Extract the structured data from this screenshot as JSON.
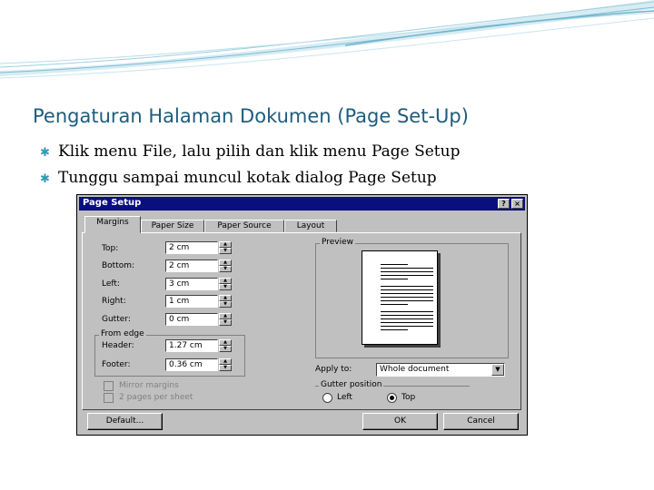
{
  "slide": {
    "title": "Pengaturan Halaman Dokumen (Page Set-Up)",
    "bullets": [
      "Klik menu File, lalu pilih dan klik menu Page Setup",
      "Tunggu sampai muncul kotak dialog Page Setup"
    ]
  },
  "dialog": {
    "title": "Page Setup",
    "title_buttons": [
      "?",
      "×"
    ],
    "tabs": [
      "Margins",
      "Paper Size",
      "Paper Source",
      "Layout"
    ],
    "fields": [
      {
        "label": "Top:",
        "value": "2 cm"
      },
      {
        "label": "Bottom:",
        "value": "2 cm"
      },
      {
        "label": "Left:",
        "value": "3 cm"
      },
      {
        "label": "Right:",
        "value": "1 cm"
      },
      {
        "label": "Gutter:",
        "value": "0 cm"
      }
    ],
    "from_edge": {
      "label": "From edge",
      "header": {
        "label": "Header:",
        "value": "1.27 cm"
      },
      "footer": {
        "label": "Footer:",
        "value": "0.36 cm"
      }
    },
    "preview_label": "Preview",
    "apply_to": {
      "label": "Apply to:",
      "value": "Whole document"
    },
    "checkboxes": [
      "Mirror margins",
      "2 pages per sheet"
    ],
    "gutter_position": {
      "label": "Gutter position",
      "options": [
        "Left",
        "Top"
      ],
      "selected": "Top"
    },
    "buttons": {
      "default": "Default...",
      "ok": "OK",
      "cancel": "Cancel"
    }
  },
  "colors": {
    "title_text": "#1e5c7d",
    "bullet_mark": "#2f9ab4",
    "dialog_bg": "#c0c0c0",
    "titlebar": "#0a0f80"
  }
}
